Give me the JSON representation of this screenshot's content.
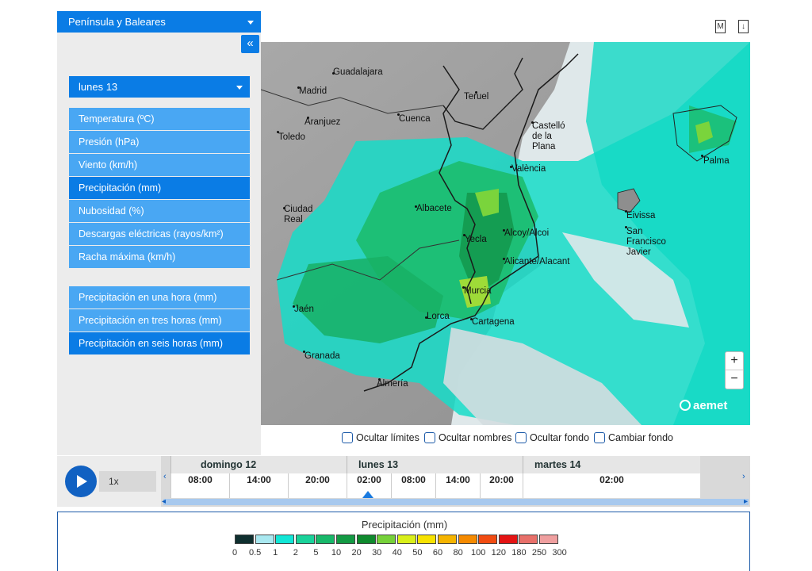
{
  "region": {
    "label": "Península y Baleares"
  },
  "collapse_label": "«",
  "day_select": {
    "label": "lunes 13"
  },
  "menu_top": [
    {
      "label": "Temperatura (ºC)",
      "active": false
    },
    {
      "label": "Presión (hPa)",
      "active": false
    },
    {
      "label": "Viento (km/h)",
      "active": false
    },
    {
      "label": "Precipitación (mm)",
      "active": true
    },
    {
      "label": "Nubosidad (%)",
      "active": false
    },
    {
      "label": "Descargas eléctricas (rayos/km²)",
      "active": false
    },
    {
      "label": "Racha máxima (km/h)",
      "active": false
    }
  ],
  "menu_bottom": [
    {
      "label": "Precipitación en una hora (mm)",
      "active": false
    },
    {
      "label": "Precipitación en tres horas (mm)",
      "active": false
    },
    {
      "label": "Precipitación en seis horas (mm)",
      "active": true
    }
  ],
  "top_icons": {
    "m_label": "M",
    "download_label": "↓"
  },
  "map": {
    "cities": [
      {
        "name": "Guadalajara"
      },
      {
        "name": "Madrid"
      },
      {
        "name": "Teruel"
      },
      {
        "name": "Cuenca"
      },
      {
        "name": "Aranjuez"
      },
      {
        "name": "Toledo"
      },
      {
        "name": "Castelló de la Plana"
      },
      {
        "name": "València"
      },
      {
        "name": "Palma"
      },
      {
        "name": "Ciudad Real"
      },
      {
        "name": "Albacete"
      },
      {
        "name": "Eivissa"
      },
      {
        "name": "San Francisco Javier"
      },
      {
        "name": "Yecla"
      },
      {
        "name": "Alcoy/Alcoi"
      },
      {
        "name": "Alicante/Alacant"
      },
      {
        "name": "Murcia"
      },
      {
        "name": "Jaén"
      },
      {
        "name": "Lorca"
      },
      {
        "name": "Cartagena"
      },
      {
        "name": "Granada"
      },
      {
        "name": "Almería"
      }
    ],
    "zoom_in": "+",
    "zoom_out": "−",
    "logo": "aemet"
  },
  "options": [
    {
      "label": "Ocultar límites",
      "checked": false
    },
    {
      "label": "Ocultar nombres",
      "checked": false
    },
    {
      "label": "Ocultar fondo",
      "checked": false
    },
    {
      "label": "Cambiar fondo",
      "checked": false
    }
  ],
  "timeline": {
    "speed": "1x",
    "fast_forward": "▶▶",
    "days": [
      "domingo 12",
      "lunes 13",
      "martes 14"
    ],
    "hours": [
      "08:00",
      "14:00",
      "20:00",
      "02:00",
      "08:00",
      "14:00",
      "20:00",
      "02:00"
    ],
    "selected_hour_index": 3,
    "nav_prev": "‹",
    "nav_next": "›",
    "scroll_prev": "◂",
    "scroll_next": "▸"
  },
  "legend": {
    "title": "Precipitación (mm)",
    "ticks": [
      "0",
      "0.5",
      "1",
      "2",
      "5",
      "10",
      "20",
      "30",
      "40",
      "50",
      "60",
      "80",
      "100",
      "120",
      "180",
      "250",
      "300"
    ],
    "colors": [
      "#0f2f2f",
      "#a9e8f0",
      "#12e6d6",
      "#1ad29a",
      "#18b86a",
      "#139a44",
      "#0f8a2e",
      "#76d13a",
      "#d9ef1a",
      "#f7e200",
      "#f5b400",
      "#f58a00",
      "#f14c12",
      "#e41414",
      "#e8706a",
      "#ef9f9f"
    ]
  }
}
